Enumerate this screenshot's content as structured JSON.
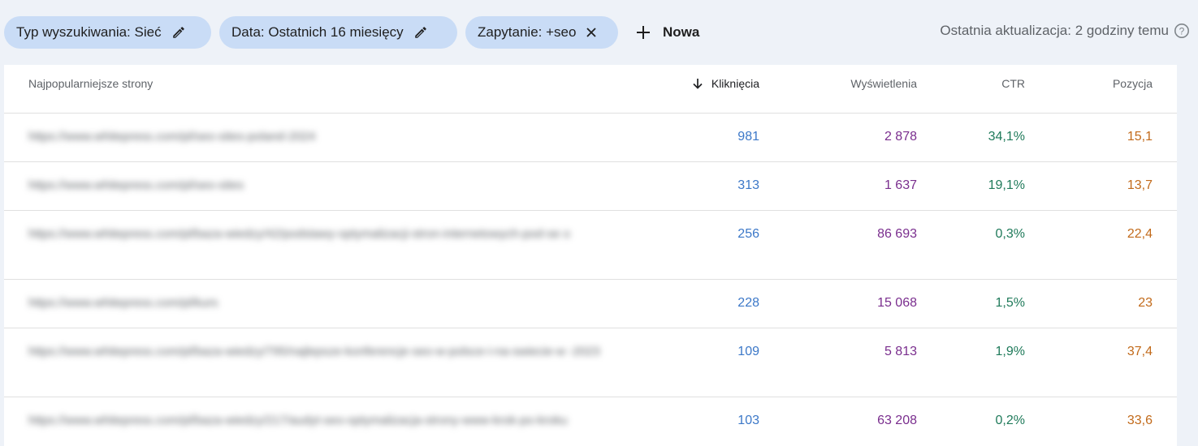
{
  "filters": {
    "search_type": "Typ wyszukiwania: Sieć",
    "date": "Data: Ostatnich 16 miesięcy",
    "query": "Zapytanie: +seo",
    "new_label": "Nowa"
  },
  "last_update": "Ostatnia aktualizacja: 2 godziny temu",
  "table": {
    "columns": {
      "pages": "Najpopularniejsze strony",
      "clicks": "Kliknięcia",
      "impressions": "Wyświetlenia",
      "ctr": "CTR",
      "position": "Pozycja"
    },
    "rows": [
      {
        "url": "https://www.whitepress.com/pl/seo-sites-poland-2024",
        "clicks": "981",
        "impressions": "2 878",
        "ctr": "34,1%",
        "position": "15,1"
      },
      {
        "url": "https://www.whitepress.com/pl/seo-sites",
        "clicks": "313",
        "impressions": "1 637",
        "ctr": "19,1%",
        "position": "13,7"
      },
      {
        "url": "https://www.whitepress.com/pl/baza-wiedzy/42/podstawy-optymalizacji-stron-internetowych-pod-se o",
        "clicks": "256",
        "impressions": "86 693",
        "ctr": "0,3%",
        "position": "22,4"
      },
      {
        "url": "https://www.whitepress.com/pl/kurs",
        "clicks": "228",
        "impressions": "15 068",
        "ctr": "1,5%",
        "position": "23"
      },
      {
        "url": "https://www.whitepress.com/pl/baza-wiedzy/795/najlepsze-konferencje-seo-w-polsce-i-na-swiecie-w -2023",
        "clicks": "109",
        "impressions": "5 813",
        "ctr": "1,9%",
        "position": "37,4"
      },
      {
        "url": "https://www.whitepress.com/pl/baza-wiedzy/217/audyt-seo-optymalizacja-strony-www-krok-po-kroku",
        "clicks": "103",
        "impressions": "63 208",
        "ctr": "0,2%",
        "position": "33,6"
      }
    ]
  }
}
